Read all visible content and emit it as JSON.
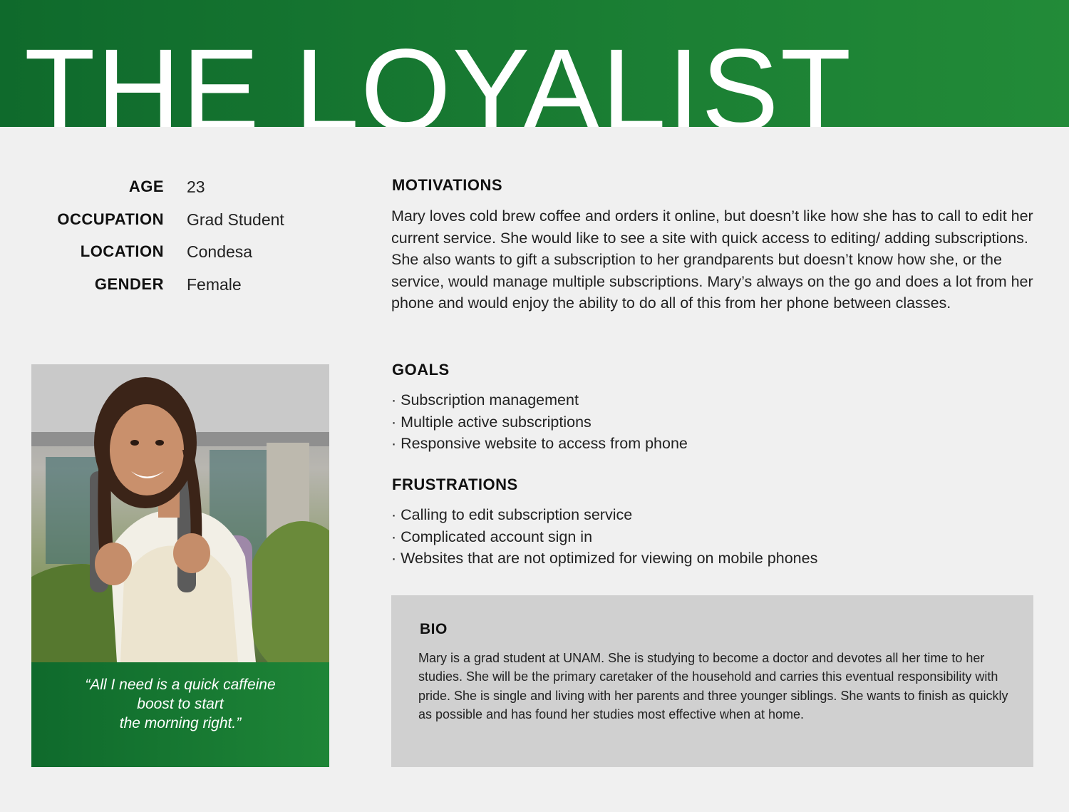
{
  "header": {
    "title": "THE LOYALIST"
  },
  "facts": [
    {
      "label": "AGE",
      "value": "23"
    },
    {
      "label": "OCCUPATION",
      "value": "Grad Student"
    },
    {
      "label": "LOCATION",
      "value": "Condesa"
    },
    {
      "label": "GENDER",
      "value": "Female"
    }
  ],
  "quote": {
    "lines": [
      "“All I need is a quick caffeine",
      "boost to start",
      "the morning right.”"
    ]
  },
  "motivations": {
    "title": "MOTIVATIONS",
    "text": "Mary loves cold brew coffee and orders it online, but doesn’t like how she has to call to edit her current service. She would like to see a site with quick access to editing/ adding subscriptions. She also wants to gift a subscription to her grandparents but doesn’t know how she, or the service, would manage multiple subscriptions. Mary’s always on the go and does a lot from her phone and would enjoy the ability to do all of this from her phone between classes."
  },
  "goals": {
    "title": "GOALS",
    "items": [
      "· Subscription management",
      "· Multiple active subscriptions",
      "· Responsive website to access from phone"
    ]
  },
  "frustrations": {
    "title": "FRUSTRATIONS",
    "items": [
      "· Calling to edit subscription service",
      "· Complicated account sign in",
      "· Websites that are not optimized for viewing on mobile phones"
    ]
  },
  "bio": {
    "title": "BIO",
    "text": "Mary is a grad student at UNAM. She is studying to become a doctor and devotes all her time to her studies. She will be the primary caretaker of the household and carries this eventual responsibility with pride. She is single and living with her parents and three younger siblings. She wants to finish as quickly as possible and has found her studies most effective when at home."
  },
  "colors": {
    "brand_green": "#1a7d33",
    "bio_bg": "#d0d0d0",
    "page_bg": "#f0f0f0"
  }
}
